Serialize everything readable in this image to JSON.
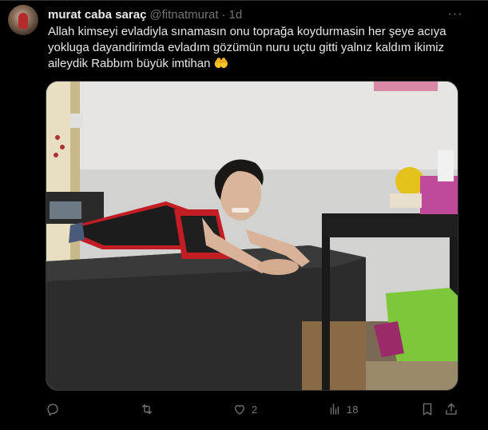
{
  "tweet": {
    "display_name": "murat caba saraç",
    "handle": "@fitnatmurat",
    "separator": "·",
    "time": "1d",
    "more_label": "···",
    "text": "Allah kimseyi evladiyla sınamasın onu toprağa koydurmasin her şeye acıya yokluga dayandirimda evladım gözümün nuru uçtu gitti yalnız kaldım ikimiz aileydik Rabbım büyük imtihan 🤲"
  },
  "actions": {
    "reply_count": "",
    "retweet_count": "",
    "like_count": "2",
    "views_count": "18"
  },
  "icons": {
    "reply": "reply-icon",
    "retweet": "retweet-icon",
    "like": "heart-icon",
    "views": "views-icon",
    "bookmark": "bookmark-icon",
    "share": "share-icon",
    "more": "more-icon"
  },
  "colors": {
    "background": "#000000",
    "text": "#e7e9ea",
    "muted": "#71767b",
    "border": "#2f3336"
  }
}
